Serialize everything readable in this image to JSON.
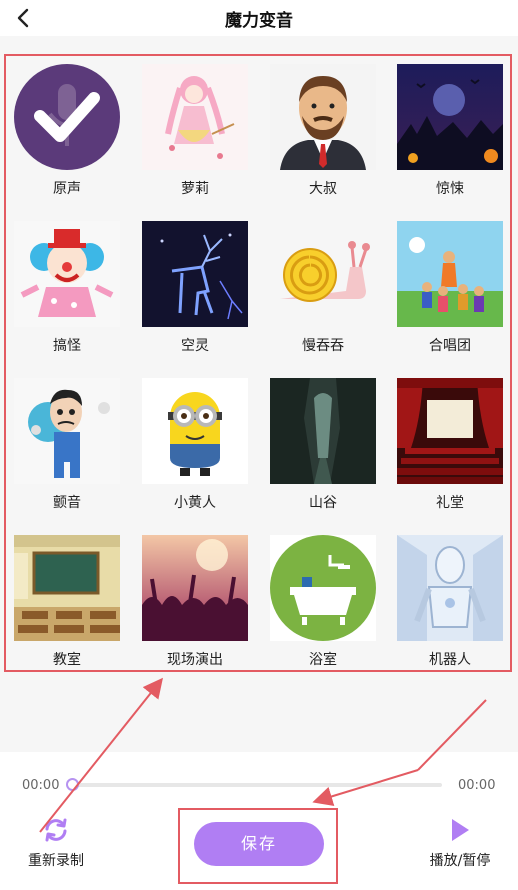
{
  "header": {
    "title": "魔力变音",
    "back_icon": "chevron-left-icon"
  },
  "effects": [
    {
      "label": "原声",
      "icon": "mic-check-icon"
    },
    {
      "label": "萝莉",
      "icon": "anime-girl-image"
    },
    {
      "label": "大叔",
      "icon": "uncle-image"
    },
    {
      "label": "惊悚",
      "icon": "haunted-night-image"
    },
    {
      "label": "搞怪",
      "icon": "clown-image"
    },
    {
      "label": "空灵",
      "icon": "ethereal-deer-image"
    },
    {
      "label": "慢吞吞",
      "icon": "snail-image"
    },
    {
      "label": "合唱团",
      "icon": "choir-image"
    },
    {
      "label": "颤音",
      "icon": "shivering-man-image"
    },
    {
      "label": "小黄人",
      "icon": "minion-image"
    },
    {
      "label": "山谷",
      "icon": "valley-image"
    },
    {
      "label": "礼堂",
      "icon": "auditorium-image"
    },
    {
      "label": "教室",
      "icon": "classroom-image"
    },
    {
      "label": "现场演出",
      "icon": "live-concert-image"
    },
    {
      "label": "浴室",
      "icon": "bathtub-image"
    },
    {
      "label": "机器人",
      "icon": "robot-image"
    }
  ],
  "player": {
    "current_time": "00:00",
    "total_time": "00:00",
    "progress": 0,
    "rerecord_label": "重新录制",
    "save_label": "保存",
    "play_pause_label": "播放/暂停"
  },
  "colors": {
    "accent": "#b07ef3",
    "annotation": "#e35b62",
    "mic_bg": "#5b3a7a"
  }
}
